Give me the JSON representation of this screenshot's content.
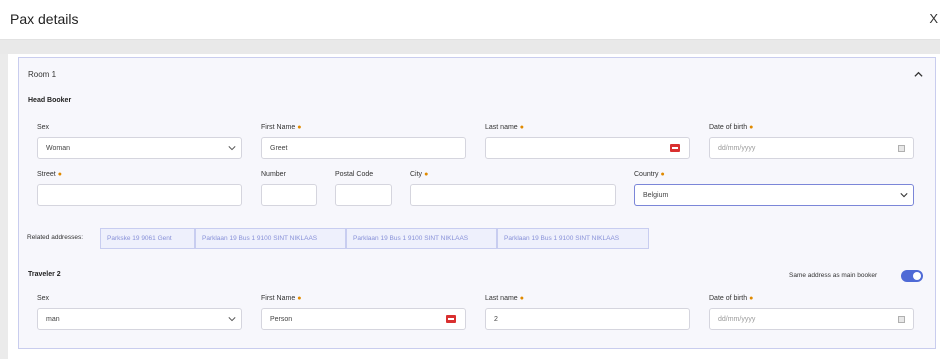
{
  "modal": {
    "title": "Pax details",
    "close_glyph": "X"
  },
  "room": {
    "title": "Room 1"
  },
  "head_booker": {
    "title": "Head Booker",
    "sex_label": "Sex",
    "sex_value": "Woman",
    "first_name_label": "First Name",
    "first_name_value": "Greet",
    "last_name_label": "Last name",
    "last_name_value": "",
    "dob_label": "Date of birth",
    "dob_placeholder": "dd/mm/yyyy",
    "street_label": "Street",
    "street_value": "",
    "number_label": "Number",
    "number_value": "",
    "postal_label": "Postal Code",
    "postal_value": "",
    "city_label": "City",
    "city_value": "",
    "country_label": "Country",
    "country_value": "Belgium"
  },
  "related": {
    "label": "Related addresses:",
    "addresses": [
      "Parkske 19 9061 Gent",
      "Parklaan 19 Bus 1 9100 SINT NIKLAAS",
      "Parklaan 19 Bus 1 9100 SINT NIKLAAS",
      "Parklaan 19 Bus 1 9100 SINT NIKLAAS"
    ]
  },
  "traveler2": {
    "title": "Traveler 2",
    "same_address_label": "Same address as main booker",
    "same_address_on": true,
    "sex_label": "Sex",
    "sex_value": "man",
    "first_name_label": "First Name",
    "first_name_value": "Person",
    "last_name_label": "Last name",
    "last_name_value": "2",
    "dob_label": "Date of birth",
    "dob_placeholder": "dd/mm/yyyy"
  },
  "colors": {
    "accent": "#4f6ad6",
    "required": "#e08a00",
    "error_badge": "#d93030",
    "panel_border": "#c9cdee"
  },
  "icons": {
    "close": "close-icon",
    "collapse": "chevron-up-icon",
    "select": "chevron-down-icon",
    "date": "calendar-icon",
    "autofill": "autofill-badge-icon"
  }
}
